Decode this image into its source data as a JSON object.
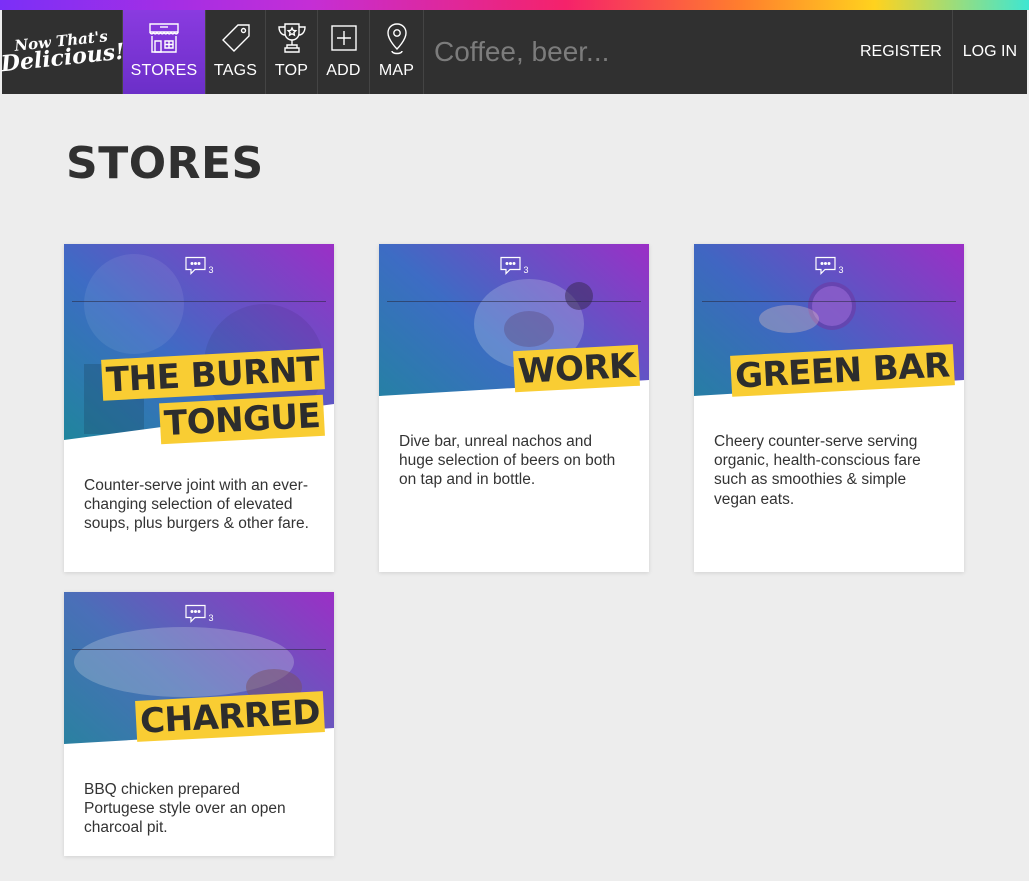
{
  "header": {
    "logo": {
      "line1": "Now That's",
      "line2": "Delicious!"
    },
    "nav": [
      {
        "label": "STORES",
        "icon": "store-icon",
        "active": true
      },
      {
        "label": "TAGS",
        "icon": "tag-icon",
        "active": false
      },
      {
        "label": "TOP",
        "icon": "trophy-icon",
        "active": false
      },
      {
        "label": "ADD",
        "icon": "add-icon",
        "active": false
      },
      {
        "label": "MAP",
        "icon": "map-pin-icon",
        "active": false
      }
    ],
    "search_placeholder": "Coffee, beer...",
    "register_label": "REGISTER",
    "login_label": "LOG IN"
  },
  "page_title": "STORES",
  "stores": [
    {
      "title_line1": "THE BURNT",
      "title_line2": "TONGUE",
      "comment_count": "3",
      "description": "Counter-serve joint with an ever-changing selection of elevated soups, plus burgers & other fare."
    },
    {
      "title_line1": "WORK",
      "title_line2": "",
      "comment_count": "3",
      "description": "Dive bar, unreal nachos and huge selection of beers on both on tap and in bottle."
    },
    {
      "title_line1": "GREEN BAR",
      "title_line2": "",
      "comment_count": "3",
      "description": "Cheery counter-serve serving organic, health-conscious fare such as smoothies & simple vegan eats."
    },
    {
      "title_line1": "CHARRED",
      "title_line2": "",
      "comment_count": "3",
      "description": "BBQ chicken prepared Portugese style over an open charcoal pit."
    }
  ],
  "colors": {
    "nav_bg": "#303030",
    "nav_active": "#7a35d8",
    "title_highlight": "#f9cd33",
    "page_bg": "#ededed"
  }
}
